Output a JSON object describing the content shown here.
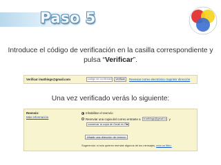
{
  "title": "Paso 5",
  "instruction": {
    "line1": "Introduce el código de verificación en la casilla correspondiente y",
    "line2_prefix": "pulsa “",
    "line2_bold": "Verificar",
    "line2_suffix": "”."
  },
  "screenshot1": {
    "label": "Verificar imathings@gmail.com",
    "code_placeholder": "código de confirmación",
    "verify_button": "Verificar",
    "links": "Reenviar correo electrónico Suprimir dirección"
  },
  "subtitle": "Una vez verificado verás lo siguiente:",
  "screenshot2": {
    "section_title": "Reenvío:",
    "more_info": "Más información",
    "option1": "Inhabilitar el reenvío",
    "option2_prefix": "Reenviar una copia del correo entrante a",
    "option2_email": "imathings@gmail.com",
    "option2_suffix": "y",
    "keep_copy_option": "conservar la copia de Gmail en Recibidos",
    "add_button": "Añadir una dirección de reenvío",
    "tip_prefix": "Sugerencia: si solo quieres reenviar algunos de tus mensajes,",
    "tip_link": "crea un filtro."
  }
}
